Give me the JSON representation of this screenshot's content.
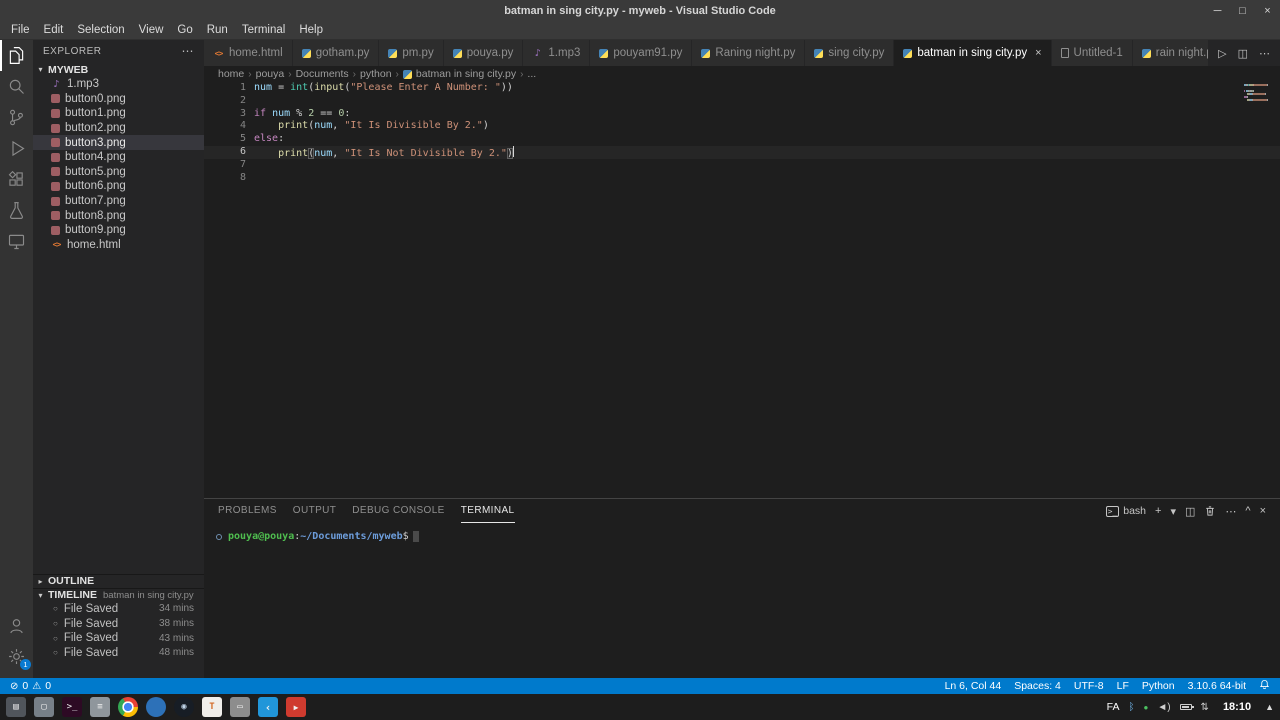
{
  "titlebar": {
    "title": "batman in sing city.py - myweb - Visual Studio Code"
  },
  "menubar": {
    "items": [
      "File",
      "Edit",
      "Selection",
      "View",
      "Go",
      "Run",
      "Terminal",
      "Help"
    ]
  },
  "activitybar": {
    "top": [
      {
        "name": "explorer",
        "active": true
      },
      {
        "name": "search"
      },
      {
        "name": "source-control"
      },
      {
        "name": "run-debug"
      },
      {
        "name": "extensions"
      },
      {
        "name": "testing"
      },
      {
        "name": "remote-explorer"
      }
    ],
    "bottom": [
      {
        "name": "account"
      },
      {
        "name": "settings",
        "badge": "1"
      }
    ]
  },
  "sidebar": {
    "title": "EXPLORER",
    "section": "MYWEB",
    "files": [
      {
        "name": "1.mp3",
        "type": "audio"
      },
      {
        "name": "button0.png",
        "type": "image"
      },
      {
        "name": "button1.png",
        "type": "image"
      },
      {
        "name": "button2.png",
        "type": "image"
      },
      {
        "name": "button3.png",
        "type": "image",
        "selected": true
      },
      {
        "name": "button4.png",
        "type": "image"
      },
      {
        "name": "button5.png",
        "type": "image"
      },
      {
        "name": "button6.png",
        "type": "image"
      },
      {
        "name": "button7.png",
        "type": "image"
      },
      {
        "name": "button8.png",
        "type": "image"
      },
      {
        "name": "button9.png",
        "type": "image"
      },
      {
        "name": "home.html",
        "type": "html"
      }
    ],
    "outline": {
      "label": "OUTLINE"
    },
    "timeline": {
      "label": "TIMELINE",
      "context": "batman in sing city.py",
      "entries": [
        {
          "label": "File Saved",
          "time": "34 mins"
        },
        {
          "label": "File Saved",
          "time": "38 mins"
        },
        {
          "label": "File Saved",
          "time": "43 mins"
        },
        {
          "label": "File Saved",
          "time": "48 mins"
        }
      ]
    }
  },
  "tabs": [
    {
      "label": "home.html",
      "type": "html"
    },
    {
      "label": "gotham.py",
      "type": "python"
    },
    {
      "label": "pm.py",
      "type": "python"
    },
    {
      "label": "pouya.py",
      "type": "python"
    },
    {
      "label": "1.mp3",
      "type": "audio"
    },
    {
      "label": "pouyam91.py",
      "type": "python"
    },
    {
      "label": "Raning night.py",
      "type": "python"
    },
    {
      "label": "sing city.py",
      "type": "python"
    },
    {
      "label": "batman in sing city.py",
      "type": "python",
      "active": true
    },
    {
      "label": "Untitled-1",
      "type": "file"
    },
    {
      "label": "rain night.py",
      "type": "python",
      "truncated": true
    }
  ],
  "tab_actions": [
    "run",
    "split-editor",
    "more"
  ],
  "breadcrumb": {
    "parts": [
      "home",
      "pouya",
      "Documents",
      "python"
    ],
    "file": "batman in sing city.py",
    "tail": "..."
  },
  "editor": {
    "lines": [
      {
        "n": "1",
        "tokens": [
          [
            "num",
            "var"
          ],
          [
            " = ",
            "plain"
          ],
          [
            "int",
            "builtin"
          ],
          [
            "(",
            "plain"
          ],
          [
            "input",
            "func"
          ],
          [
            "(",
            "plain"
          ],
          [
            "\"Please Enter A Number: \"",
            "str"
          ],
          [
            "))",
            "plain"
          ]
        ]
      },
      {
        "n": "2",
        "tokens": []
      },
      {
        "n": "3",
        "tokens": [
          [
            "if",
            "kw"
          ],
          [
            " ",
            "plain"
          ],
          [
            "num",
            "var"
          ],
          [
            " % ",
            "plain"
          ],
          [
            "2",
            "num"
          ],
          [
            " == ",
            "plain"
          ],
          [
            "0",
            "num"
          ],
          [
            ":",
            "plain"
          ]
        ]
      },
      {
        "n": "4",
        "tokens": [
          [
            "    ",
            "plain"
          ],
          [
            "print",
            "func"
          ],
          [
            "(",
            "plain"
          ],
          [
            "num",
            "var"
          ],
          [
            ", ",
            "plain"
          ],
          [
            "\"It Is Divisible By 2.\"",
            "str"
          ],
          [
            ")",
            "plain"
          ]
        ]
      },
      {
        "n": "5",
        "tokens": [
          [
            "else",
            "kw"
          ],
          [
            ":",
            "plain"
          ]
        ]
      },
      {
        "n": "6",
        "current": true,
        "cursor": true,
        "tokens": [
          [
            "    ",
            "plain"
          ],
          [
            "print",
            "func"
          ],
          [
            "(",
            "plain",
            "match"
          ],
          [
            "num",
            "var"
          ],
          [
            ", ",
            "plain"
          ],
          [
            "\"It Is Not Divisible By 2.\"",
            "str"
          ],
          [
            ")",
            "plain",
            "match"
          ]
        ]
      },
      {
        "n": "7",
        "tokens": []
      },
      {
        "n": "8",
        "tokens": []
      }
    ]
  },
  "panel": {
    "tabs": [
      {
        "label": "PROBLEMS"
      },
      {
        "label": "OUTPUT"
      },
      {
        "label": "DEBUG CONSOLE"
      },
      {
        "label": "TERMINAL",
        "active": true
      }
    ],
    "shell_label": "bash",
    "actions": [
      "new-terminal",
      "dropdown",
      "split",
      "kill",
      "more",
      "maximize",
      "close"
    ],
    "terminal_prompt": {
      "user": "pouya@pouya",
      "separator": ":",
      "path": "~/Documents/myweb",
      "symbol": "$"
    }
  },
  "statusbar": {
    "errors": "0",
    "warnings": "0",
    "cursor": "Ln 6, Col 44",
    "indent": "Spaces: 4",
    "encoding": "UTF-8",
    "eol": "LF",
    "language": "Python",
    "interpreter": "3.10.6 64-bit"
  },
  "taskbar": {
    "apps": [
      "file-manager",
      "folder",
      "terminal",
      "text-editor",
      "chrome",
      "blue-app",
      "steam",
      "editor",
      "office",
      "vscode",
      "media-player"
    ],
    "tray": [
      "bluetooth",
      "shield",
      "volume",
      "battery",
      "network"
    ],
    "layout": "FA",
    "clock": "18:10"
  }
}
